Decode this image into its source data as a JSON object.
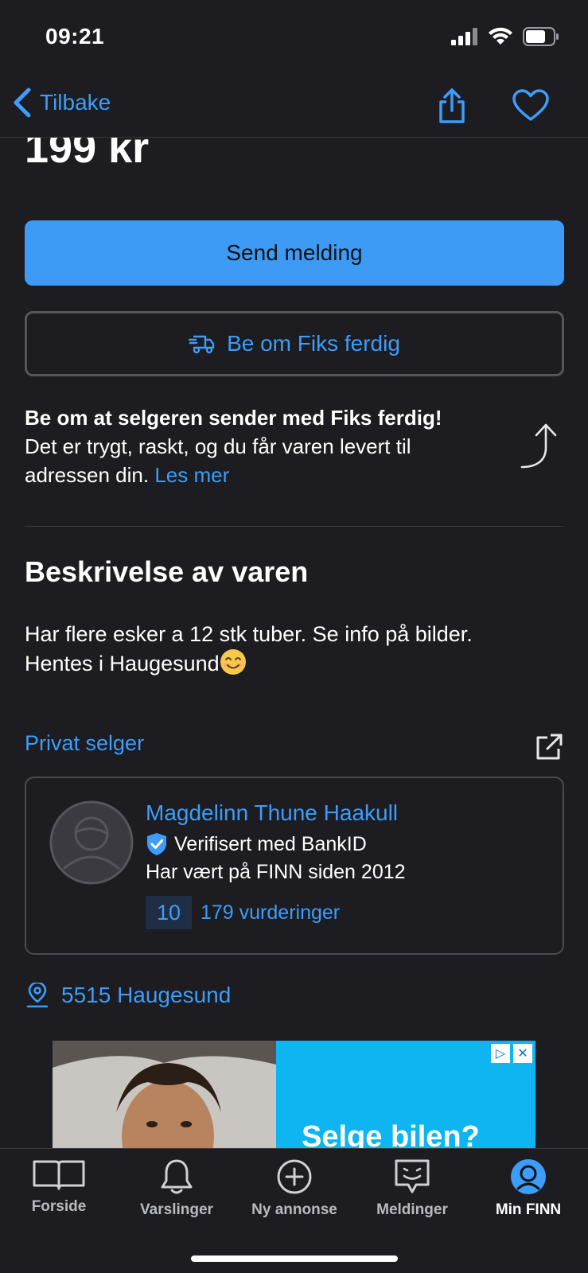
{
  "status_bar": {
    "time": "09:21"
  },
  "nav": {
    "back_label": "Tilbake"
  },
  "listing": {
    "price": "199 kr",
    "send_message_label": "Send melding",
    "fiks_button_label": "Be om Fiks ferdig",
    "fiks_info_title": "Be om at selgeren sender med Fiks ferdig!",
    "fiks_info_text": "Det er trygt, raskt, og du får varen levert til adressen din.",
    "fiks_info_link": "Les mer",
    "description_title": "Beskrivelse av varen",
    "description_line1": "Har flere esker a 12 stk tuber. Se info på bilder.",
    "description_line2": "Hentes i Haugesund"
  },
  "seller": {
    "type_label": "Privat selger",
    "name": "Magdelinn Thune Haakull",
    "verified_label": "Verifisert med BankID",
    "since_label": "Har vært på FINN siden 2012",
    "rating_score": "10",
    "rating_count_label": "179 vurderinger"
  },
  "location": {
    "label": "5515 Haugesund"
  },
  "ad": {
    "headline": "Selge bilen?"
  },
  "tab_bar": {
    "tabs": [
      {
        "label": "Forside",
        "icon": "book-open-icon"
      },
      {
        "label": "Varslinger",
        "icon": "bell-icon"
      },
      {
        "label": "Ny annonse",
        "icon": "plus-circle-icon"
      },
      {
        "label": "Meldinger",
        "icon": "chat-bubble-icon"
      },
      {
        "label": "Min FINN",
        "icon": "profile-icon"
      }
    ],
    "active": "Min FINN"
  },
  "colors": {
    "background": "#1c1c21",
    "accent": "#3d9dfa",
    "primary_button": "#3d9bf6",
    "ad_blue": "#0fb5f0"
  }
}
